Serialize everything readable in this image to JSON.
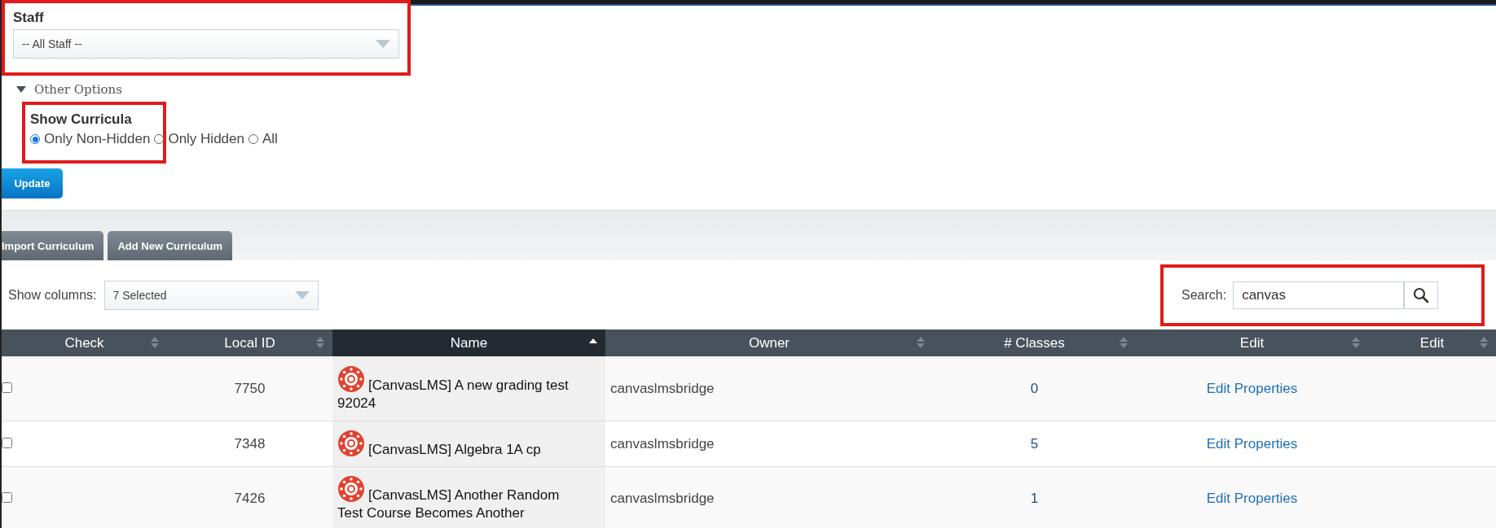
{
  "filters": {
    "staff": {
      "label": "Staff",
      "value": "-- All Staff --"
    },
    "other_options": {
      "label": "Other Options",
      "expanded": true
    },
    "show_curricula": {
      "label": "Show Curricula",
      "options": [
        {
          "label": "Only Non-Hidden",
          "selected": true
        },
        {
          "label": "Only Hidden",
          "selected": false
        },
        {
          "label": "All",
          "selected": false
        }
      ]
    },
    "update_button": "Update"
  },
  "actions": [
    "Import Curriculum",
    "Add New Curriculum"
  ],
  "show_columns": {
    "label": "Show columns:",
    "value": "7 Selected"
  },
  "search": {
    "label": "Search:",
    "value": "canvas"
  },
  "table": {
    "columns": [
      {
        "label": "Check",
        "sorted": false
      },
      {
        "label": "Local ID",
        "sorted": false
      },
      {
        "label": "Name",
        "sorted": true
      },
      {
        "label": "Owner",
        "sorted": false
      },
      {
        "label": "# Classes",
        "sorted": false
      },
      {
        "label": "Edit",
        "sorted": false
      },
      {
        "label": "Edit",
        "sorted": false
      }
    ],
    "rows": [
      {
        "checked": false,
        "local_id": "7750",
        "name": "[CanvasLMS] A new grading test 92024",
        "owner": "canvaslmsbridge",
        "classes": "0",
        "edit": "Edit Properties"
      },
      {
        "checked": false,
        "local_id": "7348",
        "name": "[CanvasLMS] Algebra 1A cp",
        "owner": "canvaslmsbridge",
        "classes": "5",
        "edit": "Edit Properties"
      },
      {
        "checked": false,
        "local_id": "7426",
        "name": "[CanvasLMS] Another Random Test Course Becomes Another",
        "owner": "canvaslmsbridge",
        "classes": "1",
        "edit": "Edit Properties"
      }
    ]
  }
}
